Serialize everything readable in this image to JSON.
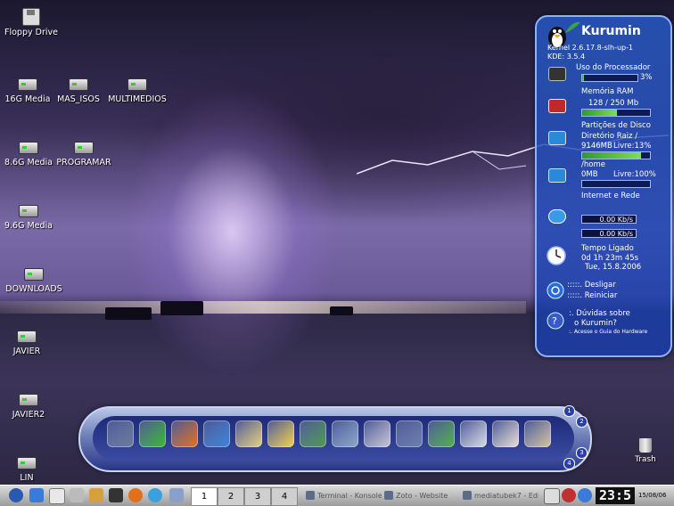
{
  "desktop_icons": [
    {
      "label": "Floppy Drive",
      "kind": "floppy"
    },
    {
      "label": "16G Media",
      "kind": "drive"
    },
    {
      "label": "MAS_ISOS",
      "kind": "drive"
    },
    {
      "label": "MULTIMEDIOS",
      "kind": "drive"
    },
    {
      "label": "8.6G Media",
      "kind": "drive"
    },
    {
      "label": "PROGRAMAR",
      "kind": "drive"
    },
    {
      "label": "9.6G Media",
      "kind": "drive"
    },
    {
      "label": "DOWNLOADS",
      "kind": "drive"
    },
    {
      "label": "JAVIER",
      "kind": "drive"
    },
    {
      "label": "JAVIER2",
      "kind": "drive"
    },
    {
      "label": "LIN",
      "kind": "drive"
    }
  ],
  "trash": {
    "label": "Trash"
  },
  "kurumin_panel": {
    "title": "Kurumin",
    "kernel": "Kernel  2.6.17.8-slh-up-1",
    "kde": "KDE: 3.5.4",
    "cpu": {
      "label": "Uso do Processador",
      "value": "3%",
      "fraction": 0.03
    },
    "ram": {
      "label": "Memória RAM",
      "value": "128 / 250 Mb",
      "fraction": 0.51
    },
    "disks": {
      "label": "Partições de Disco"
    },
    "root": {
      "label": "Diretório Raiz /",
      "size": "9146MB",
      "free": "Livre:13%",
      "fraction": 0.87
    },
    "home": {
      "label": "/home",
      "size": "0MB",
      "free": "Livre:100%",
      "fraction": 0.0
    },
    "net": {
      "label": "Internet e Rede",
      "down": "0.00 Kb/s",
      "up": "0.00 Kb/s"
    },
    "uptime": {
      "label": "Tempo Ligado",
      "value": "0d 1h 23m 45s",
      "date": "Tue, 15.8.2006"
    },
    "power": {
      "shutdown": ":::::. Desligar",
      "restart": ":::::. Reiniciar"
    },
    "help": {
      "line1": ":. Dúvidas sobre",
      "line2": "o Kurumin?",
      "line3": ":. Acesse o Guia do Hardware"
    }
  },
  "dock": {
    "items": [
      {
        "name": "computer",
        "color": "#6a7b9a"
      },
      {
        "name": "icq-flower",
        "color": "#39b82c"
      },
      {
        "name": "firefox",
        "color": "#e0701a"
      },
      {
        "name": "home",
        "color": "#3b82d8"
      },
      {
        "name": "text-editor",
        "color": "#e6d07a"
      },
      {
        "name": "notes",
        "color": "#f2d24a"
      },
      {
        "name": "office",
        "color": "#4e9b4a"
      },
      {
        "name": "photo-camera",
        "color": "#8aa8c8"
      },
      {
        "name": "cd-player",
        "color": "#c8c8d0"
      },
      {
        "name": "calculator",
        "color": "#6a7ea8"
      },
      {
        "name": "network",
        "color": "#4fb04a"
      },
      {
        "name": "printer",
        "color": "#d9dde4"
      },
      {
        "name": "cards-game",
        "color": "#e8e0d0"
      },
      {
        "name": "settings-tools",
        "color": "#d0c4a0"
      }
    ],
    "numbers": [
      "1",
      "2",
      "3",
      "4"
    ]
  },
  "taskbar": {
    "desktops": [
      "1",
      "2",
      "3",
      "4"
    ],
    "active_desktop": "1",
    "tasks": [
      "Terminal - Konsole",
      "Zoto - Website",
      "mediatubek7 - Editor"
    ],
    "clock": "23:5",
    "date": "15/08/06"
  }
}
